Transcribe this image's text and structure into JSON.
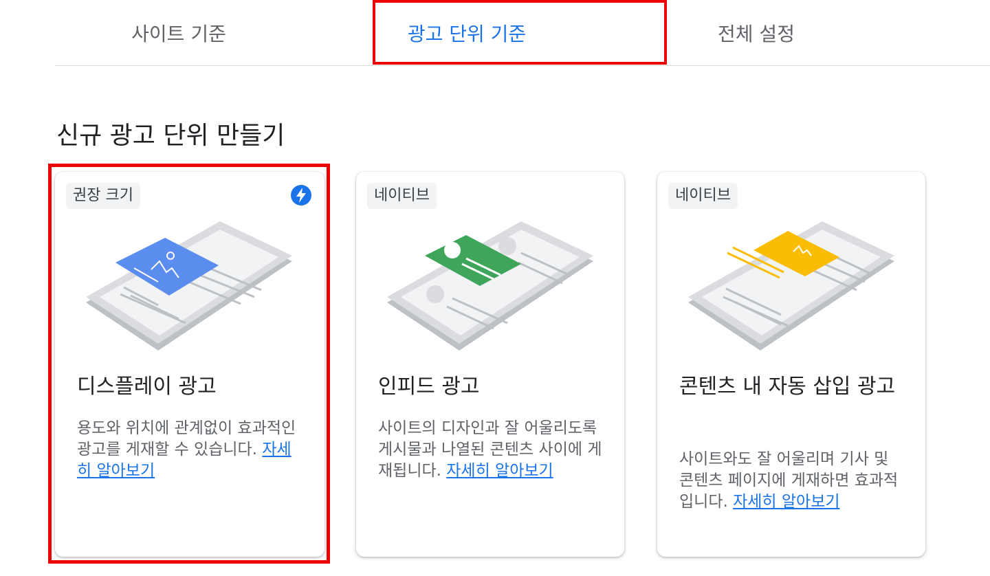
{
  "tabs": [
    {
      "label": "사이트 기준",
      "active": false
    },
    {
      "label": "광고 단위 기준",
      "active": true
    },
    {
      "label": "전체 설정",
      "active": false
    }
  ],
  "section_title": "신규 광고 단위 만들기",
  "cards": [
    {
      "chip": "권장 크기",
      "icon": "bolt-icon",
      "accent_color": "#5b8def",
      "title": "디스플레이 광고",
      "description": "용도와 위치에 관계없이 효과적인 광고를 게재할 수 있습니다. ",
      "link": "자세히 알아보기"
    },
    {
      "chip": "네이티브",
      "accent_color": "#3fa55b",
      "title": "인피드 광고",
      "description": "사이트의 디자인과 잘 어울리도록 게시물과 나열된 콘텐츠 사이에 게재됩니다. ",
      "link": "자세히 알아보기"
    },
    {
      "chip": "네이티브",
      "accent_color": "#fbbc04",
      "title": "콘텐츠 내 자동 삽입 광고",
      "description": "사이트와도 잘 어울리며 기사 및 콘텐츠 페이지에 게재하면 효과적입니다. ",
      "link": "자세히 알아보기"
    }
  ],
  "colors": {
    "tab_active": "#1a73e8",
    "highlight": "#ee0000",
    "link": "#1a73e8"
  }
}
